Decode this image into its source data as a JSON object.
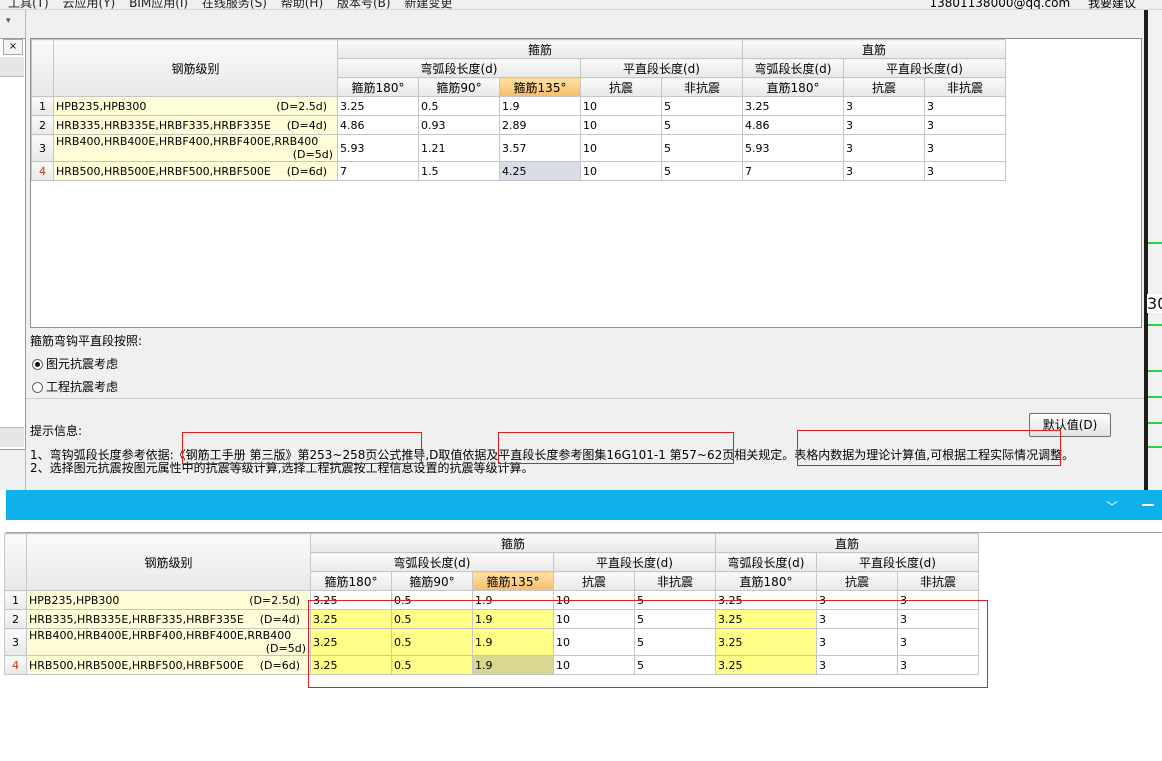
{
  "app": {
    "menu_items": [
      "工具(T)",
      "云应用(Y)",
      "BIM应用(I)",
      "在线服务(S)",
      "帮助(H)",
      "版本号(B)",
      "新建变更"
    ],
    "right_items": [
      "13801138000@qq.com",
      "我要建议"
    ],
    "close_glyph": "×",
    "dropdown_glyph": "▾"
  },
  "table": {
    "headers": {
      "level": "钢筋级别",
      "stirrup": "箍筋",
      "straight": "直筋",
      "arc_length": "弯弧段长度(d)",
      "flat_length": "平直段长度(d)",
      "stirrup_180": "箍筋180°",
      "stirrup_90": "箍筋90°",
      "stirrup_135": "箍筋135°",
      "seismic": "抗震",
      "non_seismic": "非抗震",
      "straight_180": "直筋180°"
    },
    "rows": [
      {
        "no": "1",
        "level": "HPB235,HPB300",
        "d": "(D=2.5d)",
        "s180": "3.25",
        "s90": "0.5",
        "s135": "1.9",
        "seismic": "10",
        "non_seismic": "5",
        "z180": "3.25",
        "z_seismic": "3",
        "z_non_seismic": "3"
      },
      {
        "no": "2",
        "level": "HRB335,HRB335E,HRBF335,HRBF335E",
        "d": "(D=4d)",
        "s180": "4.86",
        "s90": "0.93",
        "s135": "2.89",
        "seismic": "10",
        "non_seismic": "5",
        "z180": "4.86",
        "z_seismic": "3",
        "z_non_seismic": "3"
      },
      {
        "no": "3",
        "level": "HRB400,HRB400E,HRBF400,HRBF400E,RRB400",
        "d": "(D=5d)",
        "s180": "5.93",
        "s90": "1.21",
        "s135": "3.57",
        "seismic": "10",
        "non_seismic": "5",
        "z180": "5.93",
        "z_seismic": "3",
        "z_non_seismic": "3"
      },
      {
        "no": "4",
        "level": "HRB500,HRB500E,HRBF500,HRBF500E",
        "d": "(D=6d)",
        "s180": "7",
        "s90": "1.5",
        "s135": "4.25",
        "seismic": "10",
        "non_seismic": "5",
        "z180": "7",
        "z_seismic": "3",
        "z_non_seismic": "3"
      }
    ]
  },
  "options": {
    "title": "箍筋弯钩平直段按照:",
    "radio1": "图元抗震考虑",
    "radio2": "工程抗震考虑",
    "selected": "radio1"
  },
  "tips": {
    "title": "提示信息:",
    "line1": "1、弯钩弧段长度参考依据:《钢筋工手册 第三版》第253~258页公式推导,D取值依据及平直段长度参考图集16G101-1 第57~62页相关规定。表格内数据为理论计算值,可根据工程实际情况调整。",
    "line2": "2、选择图元抗震按图元属性中的抗震等级计算,选择工程抗震按工程信息设置的抗震等级计算。"
  },
  "default_button": "默认值(D)",
  "right_strip_number": "30",
  "lower_window": {
    "chevron_glyph": "﹀",
    "rows": [
      {
        "no": "1",
        "level": "HPB235,HPB300",
        "d": "(D=2.5d)",
        "s180": "3.25",
        "s90": "0.5",
        "s135": "1.9",
        "seismic": "10",
        "non_seismic": "5",
        "z180": "3.25",
        "z_seismic": "3",
        "z_non_seismic": "3"
      },
      {
        "no": "2",
        "level": "HRB335,HRB335E,HRBF335,HRBF335E",
        "d": "(D=4d)",
        "s180": "3.25",
        "s90": "0.5",
        "s135": "1.9",
        "seismic": "10",
        "non_seismic": "5",
        "z180": "3.25",
        "z_seismic": "3",
        "z_non_seismic": "3"
      },
      {
        "no": "3",
        "level": "HRB400,HRB400E,HRBF400,HRBF400E,RRB400",
        "d": "(D=5d)",
        "s180": "3.25",
        "s90": "0.5",
        "s135": "1.9",
        "seismic": "10",
        "non_seismic": "5",
        "z180": "3.25",
        "z_seismic": "3",
        "z_non_seismic": "3"
      },
      {
        "no": "4",
        "level": "HRB500,HRB500E,HRBF500,HRBF500E",
        "d": "(D=6d)",
        "s180": "3.25",
        "s90": "0.5",
        "s135": "1.9",
        "seismic": "10",
        "non_seismic": "5",
        "z180": "3.25",
        "z_seismic": "3",
        "z_non_seismic": "3"
      }
    ]
  },
  "colors": {
    "title_bar": "#0fb1ea",
    "selected_header": "#f7bd6a",
    "level_cell": "#fffcd8",
    "modified_cell": "#ffff88",
    "annotation_box": "#e02020"
  }
}
